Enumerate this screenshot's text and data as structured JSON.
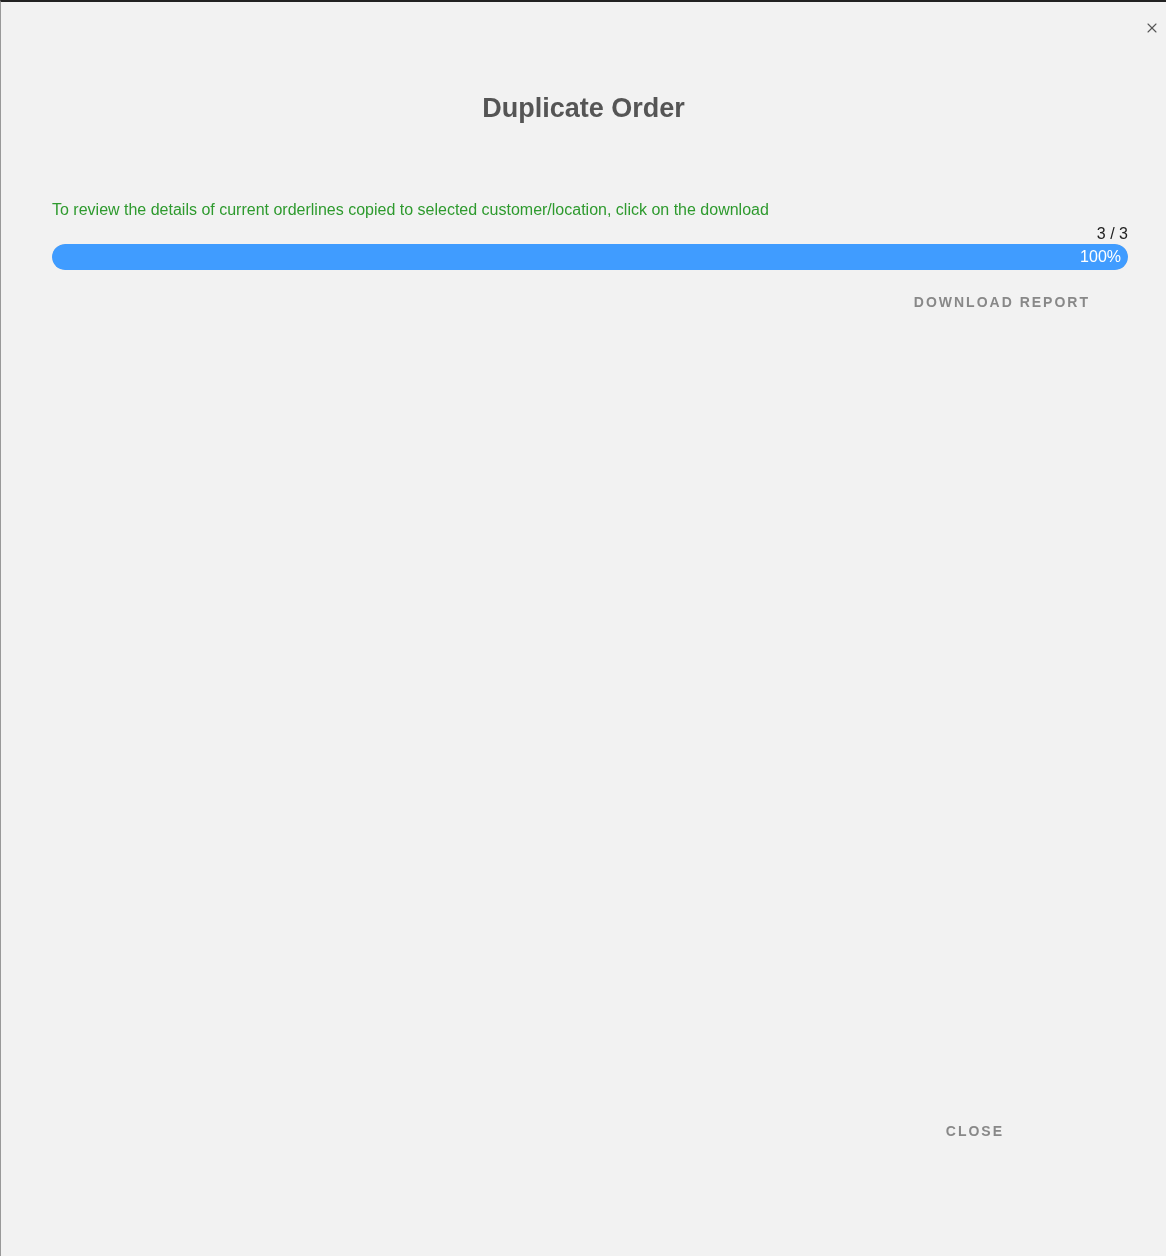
{
  "dialog": {
    "title": "Duplicate Order",
    "message": "To review the details of current orderlines copied to selected customer/location, click on the download",
    "progress": {
      "count": "3 / 3",
      "level": 1,
      "percent": "100%"
    },
    "download_button": "DOWNLOAD REPORT",
    "close_button": "CLOSE"
  }
}
